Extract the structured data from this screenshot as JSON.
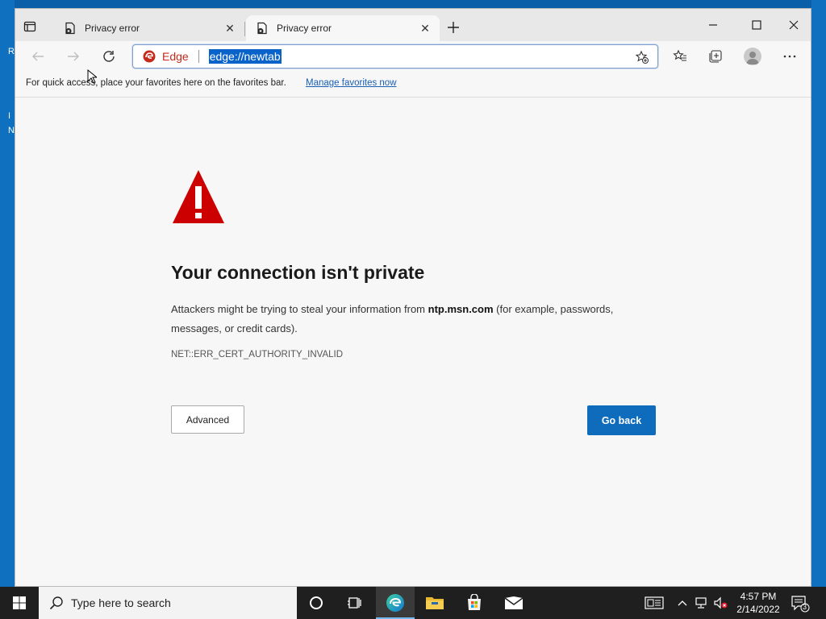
{
  "browser": {
    "tabs": [
      {
        "title": "Privacy error",
        "active": false
      },
      {
        "title": "Privacy error",
        "active": true
      }
    ],
    "address_bar": {
      "site_label": "Edge",
      "url": "edge://newtab"
    },
    "favorites_bar": {
      "message": "For quick access, place your favorites here on the favorites bar.",
      "link": "Manage favorites now"
    }
  },
  "error_page": {
    "title": "Your connection isn't private",
    "description_pre": "Attackers might be trying to steal your information from ",
    "host": "ntp.msn.com",
    "description_post": " (for example, passwords, messages, or credit cards).",
    "error_code": "NET::ERR_CERT_AUTHORITY_INVALID",
    "advanced_label": "Advanced",
    "go_back_label": "Go back",
    "accent_color": "#0f6cbd",
    "warning_color": "#cc0000"
  },
  "taskbar": {
    "search_placeholder": "Type here to search",
    "time": "4:57 PM",
    "date": "2/14/2022",
    "notification_count": "3"
  },
  "desktop": {
    "edge_glyphs": [
      "R",
      "I",
      "N"
    ]
  }
}
